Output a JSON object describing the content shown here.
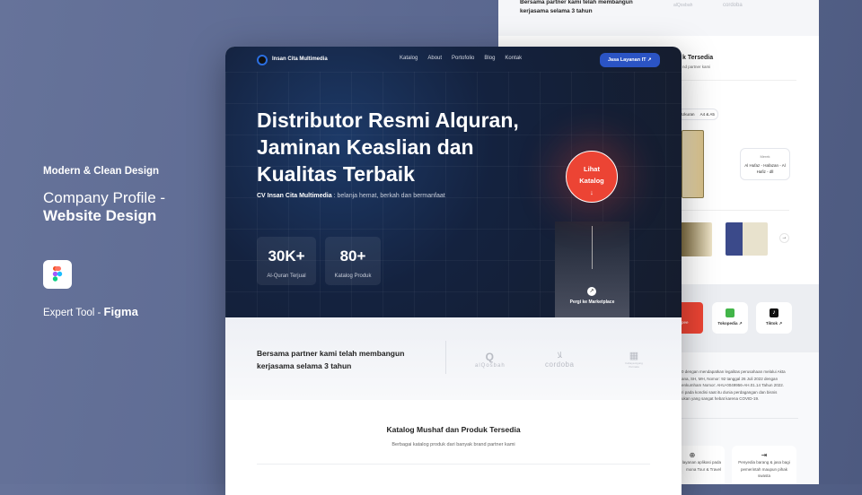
{
  "showcase": {
    "tagline": "Modern & Clean Design",
    "title_light": "Company Profile -",
    "title_bold": "Website Design",
    "tool_prefix": "Expert Tool - ",
    "tool_name": "Figma",
    "tool_icon": "figma-logo-icon"
  },
  "nav": {
    "brand": "Insan Cita Multimedia",
    "items": [
      "Katalog",
      "About",
      "Portofolio",
      "Blog",
      "Kontak"
    ],
    "cta": "Jasa Layanan IT",
    "cta_icon": "arrow-up-right-icon",
    "cta_color": "#2b54c4"
  },
  "hero": {
    "headline": [
      "Distributor Resmi Alquran,",
      "Jaminan Keaslian dan",
      "Kualitas Terbaik"
    ],
    "sub_bold": "CV Insan Cita Multimedia",
    "sub_rest": " : belanja hemat, berkah dan bermanfaat",
    "stats": [
      {
        "value": "30K+",
        "label": "Al-Quran Terjual"
      },
      {
        "value": "80+",
        "label": "Katalog Produk"
      }
    ],
    "circle_line1": "Lihat",
    "circle_line2": "Katalog",
    "circle_color": "#ec4434",
    "marketplace": "Pergi ke Marketplace"
  },
  "partners": {
    "text": "Bersama partner kami telah membangun kerjasama selama 3 tahun",
    "logos": [
      "alQosbah",
      "cordoba",
      "Cahaya Agung Permata"
    ]
  },
  "catalog": {
    "title": "Katalog Mushaf dan Produk Tersedia",
    "subtitle": "Berbagai katalog produk dari banyak brand partner kami"
  },
  "back": {
    "title_fragment": "k Tersedia",
    "sub_fragment": "nd partner kami",
    "filters": [
      "Ukuran",
      "A4 & A5"
    ],
    "brand_label": "Merek",
    "brand_value": "Al Hufaz - Hafazan - Al Hafiz - dll",
    "marketplaces": [
      {
        "label": "pee",
        "color": "#ec4434"
      },
      {
        "label": "Tokopedia",
        "color": "#ffffff"
      },
      {
        "label": "Tiktok",
        "color": "#ffffff"
      }
    ],
    "about": [
      "0 dengan mendapatkan legalitas perusahaan melalui Akta",
      "ana, SH, MH, Nomor: 92 tanggal 26 Juli 2022 dengan",
      "enkumham Nomor: AHU-0049956-AH.01.14 Tahun 2022.",
      "ri pada kondisi saat itu dunia perdagangan dan bisnis",
      "ukan yang sangat hebat karena COVID-19."
    ],
    "services": [
      "layanan aplikasi pada\nmona Tour & Travel",
      "Penyedia barang & jasa bagi\npemerintah maupun pihak\nswasta"
    ]
  }
}
